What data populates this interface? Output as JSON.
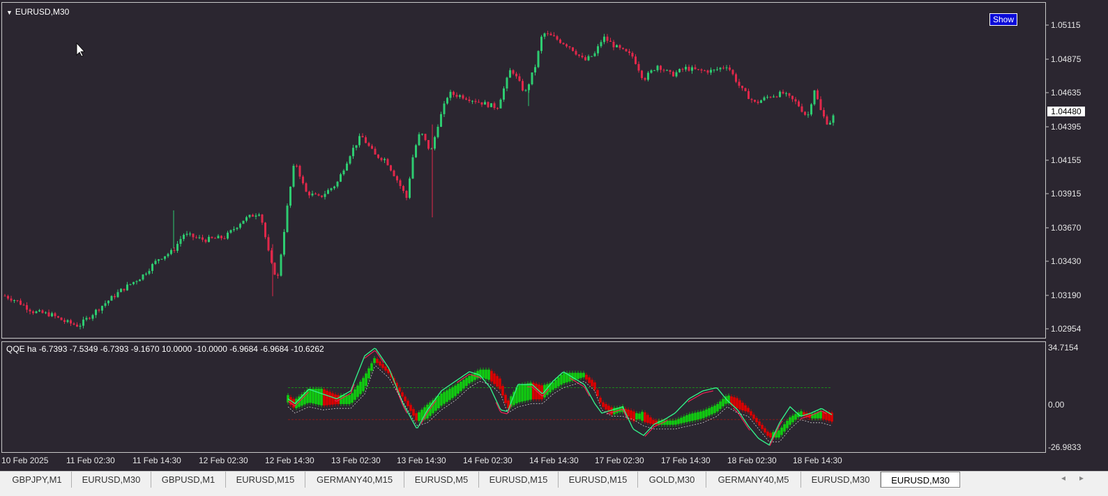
{
  "window_title": "EURUSD,M30",
  "show_button": "Show",
  "current_price": "1.04480",
  "indicator_label": "QQE ha -6.7393 -7.5349 -6.7393 -9.1670 10.0000 -10.0000 -6.9684 -6.9684 -10.6262",
  "colors": {
    "background": "#2b2630",
    "bull_candle": "#2ecc71",
    "bear_candle": "#e0284a",
    "qqe_green": "#11cc11",
    "qqe_red": "#dd0000"
  },
  "chart_data": [
    {
      "type": "candlestick",
      "title": "EURUSD,M30",
      "ylim": [
        1.02954,
        1.05115
      ],
      "y_tick_labels": [
        "1.05115",
        "1.04875",
        "1.04635",
        "1.04395",
        "1.04155",
        "1.03915",
        "1.03670",
        "1.03430",
        "1.03190",
        "1.02954"
      ],
      "x_tick_labels": [
        "10 Feb 2025",
        "11 Feb 02:30",
        "11 Feb 14:30",
        "12 Feb 02:30",
        "12 Feb 14:30",
        "13 Feb 02:30",
        "13 Feb 14:30",
        "14 Feb 02:30",
        "14 Feb 14:30",
        "17 Feb 02:30",
        "17 Feb 14:30",
        "18 Feb 02:30",
        "18 Feb 14:30"
      ],
      "close_path": [
        [
          0,
          1.0319
        ],
        [
          20,
          1.0315
        ],
        [
          45,
          1.0307
        ],
        [
          70,
          1.0305
        ],
        [
          90,
          1.03
        ],
        [
          110,
          1.0297
        ],
        [
          140,
          1.031
        ],
        [
          170,
          1.0322
        ],
        [
          200,
          1.0332
        ],
        [
          225,
          1.0345
        ],
        [
          245,
          1.035
        ],
        [
          260,
          1.0362
        ],
        [
          290,
          1.0358
        ],
        [
          320,
          1.036
        ],
        [
          345,
          1.0372
        ],
        [
          370,
          1.0378
        ],
        [
          385,
          1.0342
        ],
        [
          395,
          1.033
        ],
        [
          410,
          1.0385
        ],
        [
          420,
          1.0415
        ],
        [
          435,
          1.0392
        ],
        [
          455,
          1.0388
        ],
        [
          480,
          1.0398
        ],
        [
          500,
          1.042
        ],
        [
          515,
          1.0432
        ],
        [
          535,
          1.0418
        ],
        [
          550,
          1.0415
        ],
        [
          565,
          1.0402
        ],
        [
          580,
          1.0388
        ],
        [
          590,
          1.042
        ],
        [
          600,
          1.0435
        ],
        [
          615,
          1.042
        ],
        [
          625,
          1.044
        ],
        [
          640,
          1.0462
        ],
        [
          660,
          1.046
        ],
        [
          690,
          1.0455
        ],
        [
          710,
          1.0452
        ],
        [
          730,
          1.048
        ],
        [
          750,
          1.0462
        ],
        [
          765,
          1.0482
        ],
        [
          775,
          1.0505
        ],
        [
          790,
          1.0502
        ],
        [
          815,
          1.0495
        ],
        [
          835,
          1.0485
        ],
        [
          850,
          1.049
        ],
        [
          862,
          1.0502
        ],
        [
          880,
          1.0495
        ],
        [
          905,
          1.0488
        ],
        [
          920,
          1.0472
        ],
        [
          940,
          1.0482
        ],
        [
          960,
          1.0475
        ],
        [
          980,
          1.048
        ],
        [
          1000,
          1.0478
        ],
        [
          1020,
          1.0478
        ],
        [
          1040,
          1.0482
        ],
        [
          1060,
          1.0465
        ],
        [
          1080,
          1.0455
        ],
        [
          1100,
          1.046
        ],
        [
          1120,
          1.0462
        ],
        [
          1140,
          1.0455
        ],
        [
          1155,
          1.0445
        ],
        [
          1165,
          1.0465
        ],
        [
          1175,
          1.0448
        ],
        [
          1185,
          1.044
        ],
        [
          1195,
          1.0448
        ]
      ]
    },
    {
      "type": "line",
      "title": "QQE ha",
      "ylim": [
        -26.9833,
        34.7154
      ],
      "y_tick_labels": [
        "34.7154",
        "0.00",
        "-26.9833"
      ],
      "levels": [
        10,
        -10
      ],
      "series": [
        {
          "role": "histogram",
          "x": [
            410,
            420,
            440,
            460,
            480,
            500,
            520,
            535,
            555,
            575,
            595,
            610,
            630,
            650,
            670,
            685,
            700,
            715,
            725,
            740,
            760,
            775,
            790,
            805,
            820,
            835,
            850,
            860,
            875,
            890,
            905,
            920,
            935,
            950,
            965,
            985,
            1005,
            1025,
            1040,
            1055,
            1070,
            1085,
            1100,
            1115,
            1130,
            1145,
            1160,
            1175,
            1190
          ],
          "values": [
            4,
            1,
            8,
            8,
            4,
            4,
            16,
            28,
            20,
            5,
            -8,
            -2,
            5,
            10,
            16,
            20,
            20,
            14,
            0,
            10,
            12,
            10,
            12,
            18,
            18,
            18,
            10,
            0,
            -6,
            -3,
            -10,
            -6,
            -12,
            -12,
            -12,
            -8,
            -6,
            -2,
            4,
            2,
            -4,
            -12,
            -20,
            -18,
            -10,
            -6,
            -8,
            -6,
            -7
          ]
        },
        {
          "role": "fast",
          "x": [
            410,
            420,
            440,
            460,
            480,
            500,
            520,
            535,
            555,
            575,
            595,
            610,
            630,
            650,
            670,
            685,
            700,
            715,
            725,
            740,
            760,
            775,
            790,
            805,
            820,
            835,
            850,
            860,
            875,
            890,
            905,
            920,
            935,
            950,
            965,
            985,
            1005,
            1025,
            1040,
            1055,
            1070,
            1085,
            1100,
            1115,
            1130,
            1145,
            1160,
            1175,
            1190
          ],
          "values": [
            3,
            0,
            9,
            6,
            3,
            8,
            30,
            35,
            22,
            0,
            -16,
            -4,
            8,
            14,
            20,
            18,
            10,
            -4,
            -5,
            12,
            12,
            6,
            14,
            20,
            16,
            12,
            0,
            -6,
            -4,
            -2,
            -16,
            -20,
            -13,
            -10,
            -6,
            3,
            8,
            10,
            2,
            -4,
            -14,
            -22,
            -26,
            -12,
            -2,
            -8,
            -6,
            -3,
            -7
          ]
        },
        {
          "role": "signal",
          "x": [
            410,
            420,
            440,
            460,
            480,
            500,
            520,
            535,
            555,
            575,
            595,
            610,
            630,
            650,
            670,
            685,
            700,
            715,
            725,
            740,
            760,
            775,
            790,
            805,
            820,
            835,
            850,
            860,
            875,
            890,
            905,
            920,
            935,
            950,
            965,
            985,
            1005,
            1025,
            1040,
            1055,
            1070,
            1085,
            1100,
            1115,
            1130,
            1145,
            1160,
            1175,
            1190
          ],
          "values": [
            2,
            -2,
            2,
            0,
            1,
            1,
            10,
            28,
            20,
            5,
            -10,
            -8,
            0,
            6,
            14,
            18,
            16,
            10,
            -2,
            2,
            4,
            4,
            10,
            14,
            16,
            18,
            12,
            0,
            -4,
            -4,
            -6,
            -10,
            -12,
            -12,
            -12,
            -10,
            -8,
            -4,
            2,
            -2,
            -4,
            -12,
            -20,
            -20,
            -12,
            -6,
            -8,
            -8,
            -10
          ]
        }
      ]
    }
  ],
  "tabs": [
    {
      "label": "GBPJPY,M1",
      "active": false
    },
    {
      "label": "EURUSD,M30",
      "active": false
    },
    {
      "label": "GBPUSD,M1",
      "active": false
    },
    {
      "label": "EURUSD,M15",
      "active": false
    },
    {
      "label": "GERMANY40,M15",
      "active": false
    },
    {
      "label": "EURUSD,M5",
      "active": false
    },
    {
      "label": "EURUSD,M15",
      "active": false
    },
    {
      "label": "EURUSD,M15",
      "active": false
    },
    {
      "label": "GOLD,M30",
      "active": false
    },
    {
      "label": "GERMANY40,M5",
      "active": false
    },
    {
      "label": "EURUSD,M30",
      "active": false
    },
    {
      "label": "EURUSD,M30",
      "active": true
    }
  ],
  "scroll": {
    "left": "◂",
    "right": "▸"
  }
}
